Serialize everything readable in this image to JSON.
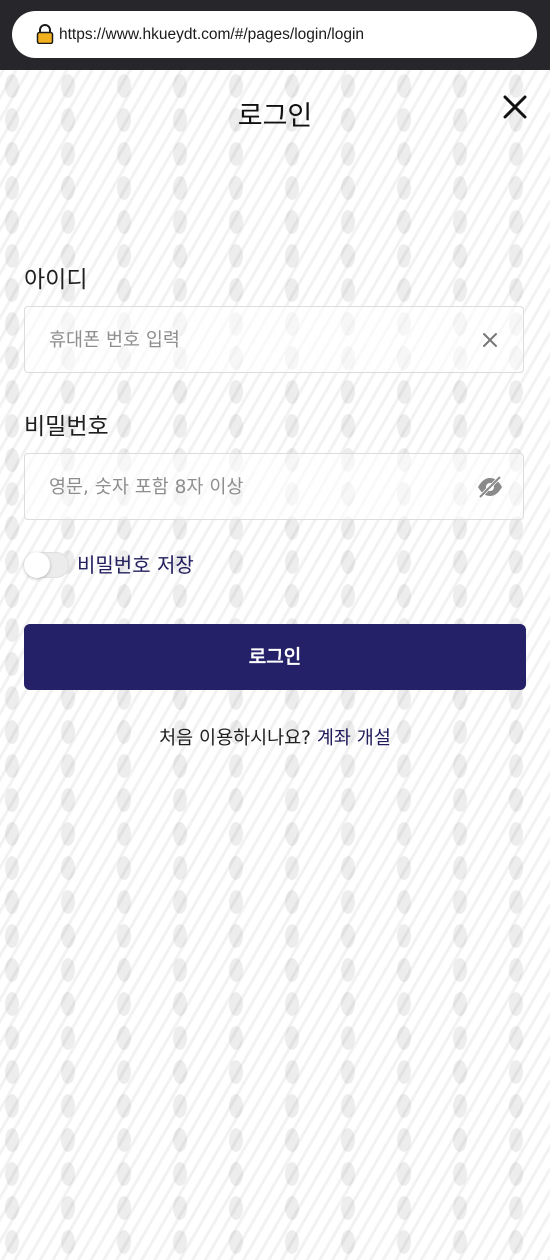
{
  "browser": {
    "url": "https://www.hkueydt.com/#/pages/login/login"
  },
  "header": {
    "title": "로그인"
  },
  "form": {
    "id_label": "아이디",
    "id_placeholder": "휴대폰 번호 입력",
    "password_label": "비밀번호",
    "password_placeholder": "영문, 숫자 포함 8자 이상",
    "save_password_label": "비밀번호 저장",
    "save_password_on": false,
    "login_button": "로그인"
  },
  "signup": {
    "prompt": "처음 이용하시나요? ",
    "link": "계좌 개설"
  },
  "colors": {
    "accent": "#242168",
    "browser_bar": "#26262b"
  },
  "icons": {
    "lock": "lock-icon",
    "close": "close-icon",
    "clear": "clear-icon",
    "eye": "eye-slash-icon"
  }
}
